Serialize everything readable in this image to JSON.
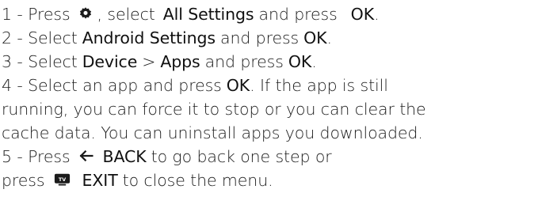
{
  "instructions": {
    "step1": {
      "prefix": "1 -  Press",
      "icon": "gear-icon",
      "mid": ", select",
      "bold1": "All Settings",
      "mid2": "and press",
      "bold2": "OK",
      "end": "."
    },
    "step2": {
      "prefix": "2 -  Select",
      "bold1": "Android Settings",
      "mid": "and press",
      "bold2": "OK",
      "end": "."
    },
    "step3": {
      "prefix": "3 -  Select",
      "bold1": "Device",
      "sep": ">",
      "bold2": "Apps",
      "mid": "and press",
      "bold3": "OK",
      "end": "."
    },
    "step4": {
      "prefix": "4 -  Select an app and press",
      "bold1": "OK",
      "rest": ". If the app is still",
      "line2": "running, you can force it to stop or you can clear the",
      "line3": "cache data. You can uninstall apps you downloaded."
    },
    "step5": {
      "prefix": "5 -  Press",
      "icon1": "back-arrow-icon",
      "bold1": "BACK",
      "rest": "to go back one step or",
      "line2_prefix": "press",
      "icon2": "tv-icon",
      "bold2": "EXIT",
      "line2_rest": "to close the menu."
    }
  }
}
